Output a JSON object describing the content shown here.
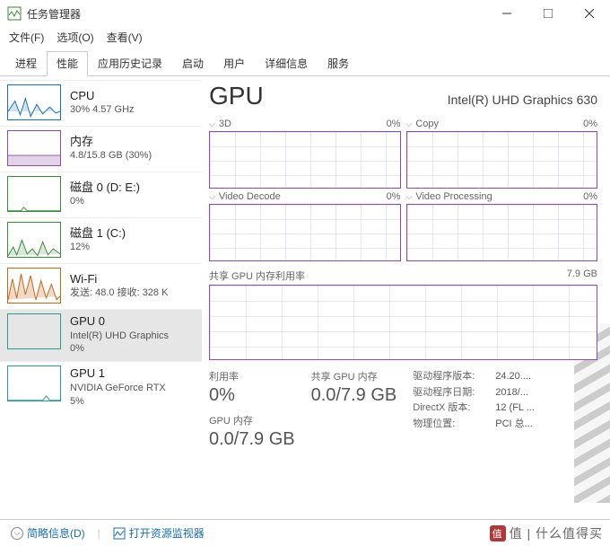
{
  "window": {
    "title": "任务管理器",
    "controls": {
      "minimize": "minimize",
      "maximize": "maximize",
      "close": "close"
    }
  },
  "menu": {
    "file": "文件(F)",
    "options": "选项(O)",
    "view": "查看(V)"
  },
  "tabs": {
    "items": [
      "进程",
      "性能",
      "应用历史记录",
      "启动",
      "用户",
      "详细信息",
      "服务"
    ],
    "active_index": 1
  },
  "sidebar": [
    {
      "title": "CPU",
      "sub": "30% 4.57 GHz",
      "color": "blue"
    },
    {
      "title": "内存",
      "sub": "4.8/15.8 GB (30%)",
      "color": "purple"
    },
    {
      "title": "磁盘 0 (D: E:)",
      "sub": "0%",
      "color": "green"
    },
    {
      "title": "磁盘 1 (C:)",
      "sub": "12%",
      "color": "green"
    },
    {
      "title": "Wi-Fi",
      "sub": "发送: 48.0 接收: 328 K",
      "color": "orange"
    },
    {
      "title": "GPU 0",
      "sub": "Intel(R) UHD Graphics",
      "sub2": "0%",
      "color": "teal",
      "selected": true
    },
    {
      "title": "GPU 1",
      "sub": "NVIDIA GeForce RTX",
      "sub2": "5%",
      "color": "teal"
    }
  ],
  "gpu": {
    "heading": "GPU",
    "name": "Intel(R) UHD Graphics 630",
    "panels": {
      "p3d": {
        "label": "3D",
        "pct": "0%"
      },
      "copy": {
        "label": "Copy",
        "pct": "0%"
      },
      "decode": {
        "label": "Video Decode",
        "pct": "0%"
      },
      "processing": {
        "label": "Video Processing",
        "pct": "0%"
      }
    },
    "shared_mem": {
      "label": "共享 GPU 内存利用率",
      "max": "7.9 GB"
    },
    "stats": {
      "util_label": "利用率",
      "util_value": "0%",
      "shared_label": "共享 GPU 内存",
      "shared_value": "0.0/7.9 GB",
      "ded_label": "GPU 内存",
      "ded_value": "0.0/7.9 GB"
    },
    "meta": {
      "driver_ver_k": "驱动程序版本:",
      "driver_ver_v": "24.20....",
      "driver_date_k": "驱动程序日期:",
      "driver_date_v": "2018/...",
      "directx_k": "DirectX 版本:",
      "directx_v": "12 (FL ...",
      "loc_k": "物理位置:",
      "loc_v": "PCI 总..."
    }
  },
  "footer": {
    "summary": "简略信息(D)",
    "resmon": "打开资源监视器"
  },
  "watermark": "值 | 什么值得买"
}
